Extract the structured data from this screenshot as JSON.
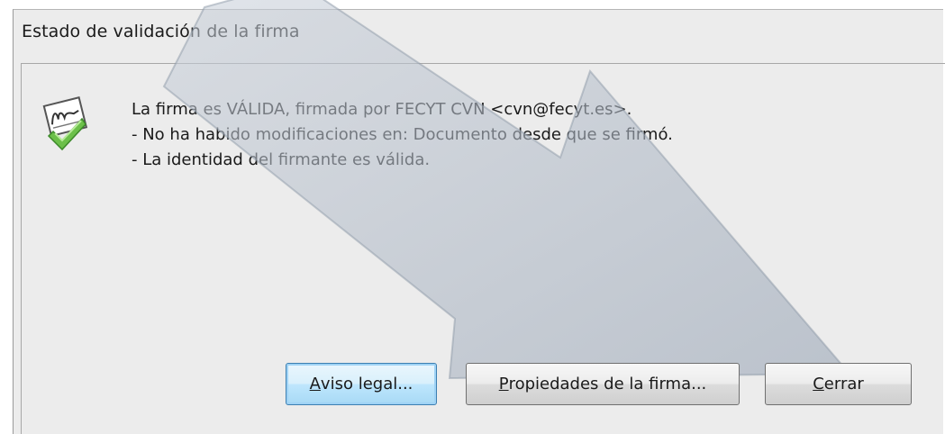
{
  "dialog": {
    "title": "Estado de validación de la firma",
    "icon": "signature-valid-checkmark-icon",
    "message_lines": [
      "La firma es VÁLIDA, firmada por FECYT CVN <cvn@fecyt.es>.",
      "- No ha habido modificaciones en: Documento desde que se firmó.",
      "- La identidad del firmante es válida."
    ]
  },
  "buttons": {
    "aviso_legal": {
      "mnemonic": "A",
      "rest": "viso legal..."
    },
    "propiedades": {
      "mnemonic": "P",
      "rest": "ropiedades de la firma..."
    },
    "cerrar": {
      "mnemonic": "C",
      "rest": "errar"
    }
  },
  "overlay": {
    "shape": "translucent-arrow-pointing-down-right",
    "color": "#a9b4c2"
  }
}
